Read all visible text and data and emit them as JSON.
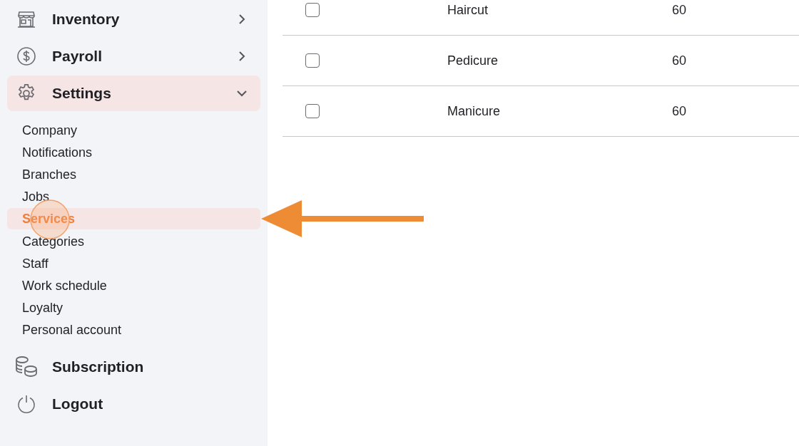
{
  "sidebar": {
    "items": [
      {
        "label": "Inventory",
        "kind": "store",
        "expanded": false,
        "selected": false
      },
      {
        "label": "Payroll",
        "kind": "dollar",
        "expanded": false,
        "selected": false
      },
      {
        "label": "Settings",
        "kind": "gear",
        "expanded": true,
        "selected": true,
        "children": [
          {
            "label": "Company",
            "selected": false
          },
          {
            "label": "Notifications",
            "selected": false
          },
          {
            "label": "Branches",
            "selected": false
          },
          {
            "label": "Jobs",
            "selected": false
          },
          {
            "label": "Services",
            "selected": true
          },
          {
            "label": "Categories",
            "selected": false
          },
          {
            "label": "Staff",
            "selected": false
          },
          {
            "label": "Work schedule",
            "selected": false
          },
          {
            "label": "Loyalty",
            "selected": false
          },
          {
            "label": "Personal account",
            "selected": false
          }
        ]
      },
      {
        "label": "Subscription",
        "kind": "coins",
        "selected": false
      },
      {
        "label": "Logout",
        "kind": "power",
        "selected": false
      }
    ]
  },
  "table": {
    "rows": [
      {
        "checked": false,
        "column_2": "Haircut",
        "column_3": "60"
      },
      {
        "checked": false,
        "column_2": "Pedicure",
        "column_3": "60"
      },
      {
        "checked": false,
        "column_2": "Manicure",
        "column_3": "60"
      }
    ]
  }
}
